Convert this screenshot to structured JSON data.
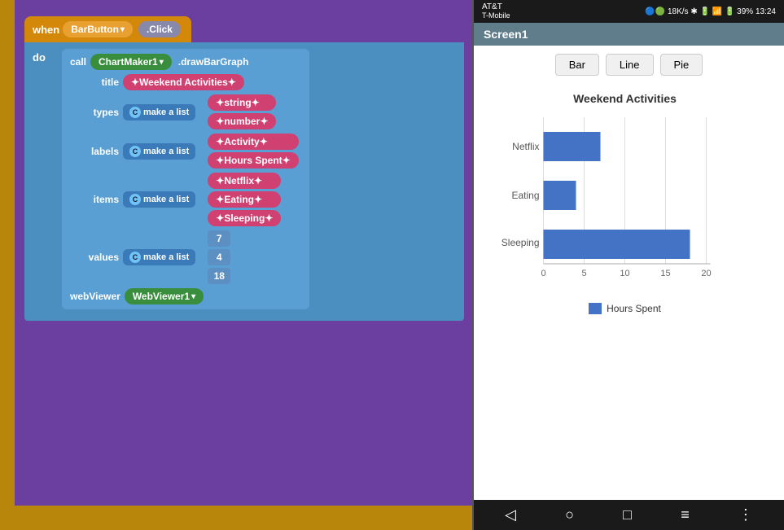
{
  "blockEditor": {
    "whenLabel": "when",
    "barButton": "BarButton",
    "click": ".Click",
    "doLabel": "do",
    "callLabel": "call",
    "chartMaker": "ChartMaker1",
    "drawMethod": ".drawBarGraph",
    "titleParam": "title",
    "titleValue": "Weekend Activities",
    "typesParam": "types",
    "typesListIcon": "C",
    "typesListLabel": "make a list",
    "typeItem1": "string",
    "typeItem2": "number",
    "labelsParam": "labels",
    "labelsListLabel": "make a list",
    "labelItem1": "Activity",
    "labelItem2": "Hours Spent",
    "itemsParam": "items",
    "itemsListLabel": "make a list",
    "itemItem1": "Netflix",
    "itemItem2": "Eating",
    "itemItem3": "Sleeping",
    "valuesParam": "values",
    "valuesListLabel": "make a list",
    "value1": "7",
    "value2": "4",
    "value3": "18",
    "webViewerParam": "webViewer",
    "webViewer1": "WebViewer1"
  },
  "phone": {
    "statusBar": {
      "carrier": "AT&T",
      "carrier2": "T-Mobile",
      "speed": "18K/s",
      "time": "13:24",
      "battery": "39%"
    },
    "screenTitle": "Screen1",
    "buttons": {
      "bar": "Bar",
      "line": "Line",
      "pie": "Pie"
    },
    "chart": {
      "title": "Weekend Activities",
      "bars": [
        {
          "label": "Netflix",
          "value": 7,
          "maxValue": 20
        },
        {
          "label": "Eating",
          "value": 4,
          "maxValue": 20
        },
        {
          "label": "Sleeping",
          "value": 18,
          "maxValue": 20
        }
      ],
      "xTicks": [
        "0",
        "5",
        "10",
        "15",
        "20"
      ],
      "legendColor": "#4472c4",
      "legendLabel": "Hours Spent"
    },
    "navIcons": {
      "back": "◁",
      "home": "○",
      "recents": "□",
      "menu1": "≡",
      "menu2": "⋮"
    }
  }
}
